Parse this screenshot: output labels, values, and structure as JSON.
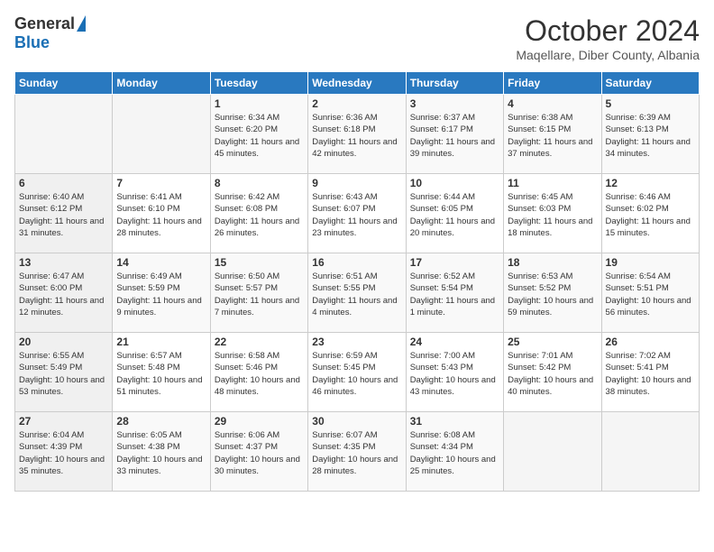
{
  "header": {
    "logo_general": "General",
    "logo_blue": "Blue",
    "month": "October 2024",
    "location": "Maqellare, Diber County, Albania"
  },
  "days_of_week": [
    "Sunday",
    "Monday",
    "Tuesday",
    "Wednesday",
    "Thursday",
    "Friday",
    "Saturday"
  ],
  "weeks": [
    [
      {
        "day": "",
        "info": ""
      },
      {
        "day": "",
        "info": ""
      },
      {
        "day": "1",
        "info": "Sunrise: 6:34 AM\nSunset: 6:20 PM\nDaylight: 11 hours and 45 minutes."
      },
      {
        "day": "2",
        "info": "Sunrise: 6:36 AM\nSunset: 6:18 PM\nDaylight: 11 hours and 42 minutes."
      },
      {
        "day": "3",
        "info": "Sunrise: 6:37 AM\nSunset: 6:17 PM\nDaylight: 11 hours and 39 minutes."
      },
      {
        "day": "4",
        "info": "Sunrise: 6:38 AM\nSunset: 6:15 PM\nDaylight: 11 hours and 37 minutes."
      },
      {
        "day": "5",
        "info": "Sunrise: 6:39 AM\nSunset: 6:13 PM\nDaylight: 11 hours and 34 minutes."
      }
    ],
    [
      {
        "day": "6",
        "info": "Sunrise: 6:40 AM\nSunset: 6:12 PM\nDaylight: 11 hours and 31 minutes."
      },
      {
        "day": "7",
        "info": "Sunrise: 6:41 AM\nSunset: 6:10 PM\nDaylight: 11 hours and 28 minutes."
      },
      {
        "day": "8",
        "info": "Sunrise: 6:42 AM\nSunset: 6:08 PM\nDaylight: 11 hours and 26 minutes."
      },
      {
        "day": "9",
        "info": "Sunrise: 6:43 AM\nSunset: 6:07 PM\nDaylight: 11 hours and 23 minutes."
      },
      {
        "day": "10",
        "info": "Sunrise: 6:44 AM\nSunset: 6:05 PM\nDaylight: 11 hours and 20 minutes."
      },
      {
        "day": "11",
        "info": "Sunrise: 6:45 AM\nSunset: 6:03 PM\nDaylight: 11 hours and 18 minutes."
      },
      {
        "day": "12",
        "info": "Sunrise: 6:46 AM\nSunset: 6:02 PM\nDaylight: 11 hours and 15 minutes."
      }
    ],
    [
      {
        "day": "13",
        "info": "Sunrise: 6:47 AM\nSunset: 6:00 PM\nDaylight: 11 hours and 12 minutes."
      },
      {
        "day": "14",
        "info": "Sunrise: 6:49 AM\nSunset: 5:59 PM\nDaylight: 11 hours and 9 minutes."
      },
      {
        "day": "15",
        "info": "Sunrise: 6:50 AM\nSunset: 5:57 PM\nDaylight: 11 hours and 7 minutes."
      },
      {
        "day": "16",
        "info": "Sunrise: 6:51 AM\nSunset: 5:55 PM\nDaylight: 11 hours and 4 minutes."
      },
      {
        "day": "17",
        "info": "Sunrise: 6:52 AM\nSunset: 5:54 PM\nDaylight: 11 hours and 1 minute."
      },
      {
        "day": "18",
        "info": "Sunrise: 6:53 AM\nSunset: 5:52 PM\nDaylight: 10 hours and 59 minutes."
      },
      {
        "day": "19",
        "info": "Sunrise: 6:54 AM\nSunset: 5:51 PM\nDaylight: 10 hours and 56 minutes."
      }
    ],
    [
      {
        "day": "20",
        "info": "Sunrise: 6:55 AM\nSunset: 5:49 PM\nDaylight: 10 hours and 53 minutes."
      },
      {
        "day": "21",
        "info": "Sunrise: 6:57 AM\nSunset: 5:48 PM\nDaylight: 10 hours and 51 minutes."
      },
      {
        "day": "22",
        "info": "Sunrise: 6:58 AM\nSunset: 5:46 PM\nDaylight: 10 hours and 48 minutes."
      },
      {
        "day": "23",
        "info": "Sunrise: 6:59 AM\nSunset: 5:45 PM\nDaylight: 10 hours and 46 minutes."
      },
      {
        "day": "24",
        "info": "Sunrise: 7:00 AM\nSunset: 5:43 PM\nDaylight: 10 hours and 43 minutes."
      },
      {
        "day": "25",
        "info": "Sunrise: 7:01 AM\nSunset: 5:42 PM\nDaylight: 10 hours and 40 minutes."
      },
      {
        "day": "26",
        "info": "Sunrise: 7:02 AM\nSunset: 5:41 PM\nDaylight: 10 hours and 38 minutes."
      }
    ],
    [
      {
        "day": "27",
        "info": "Sunrise: 6:04 AM\nSunset: 4:39 PM\nDaylight: 10 hours and 35 minutes."
      },
      {
        "day": "28",
        "info": "Sunrise: 6:05 AM\nSunset: 4:38 PM\nDaylight: 10 hours and 33 minutes."
      },
      {
        "day": "29",
        "info": "Sunrise: 6:06 AM\nSunset: 4:37 PM\nDaylight: 10 hours and 30 minutes."
      },
      {
        "day": "30",
        "info": "Sunrise: 6:07 AM\nSunset: 4:35 PM\nDaylight: 10 hours and 28 minutes."
      },
      {
        "day": "31",
        "info": "Sunrise: 6:08 AM\nSunset: 4:34 PM\nDaylight: 10 hours and 25 minutes."
      },
      {
        "day": "",
        "info": ""
      },
      {
        "day": "",
        "info": ""
      }
    ]
  ]
}
